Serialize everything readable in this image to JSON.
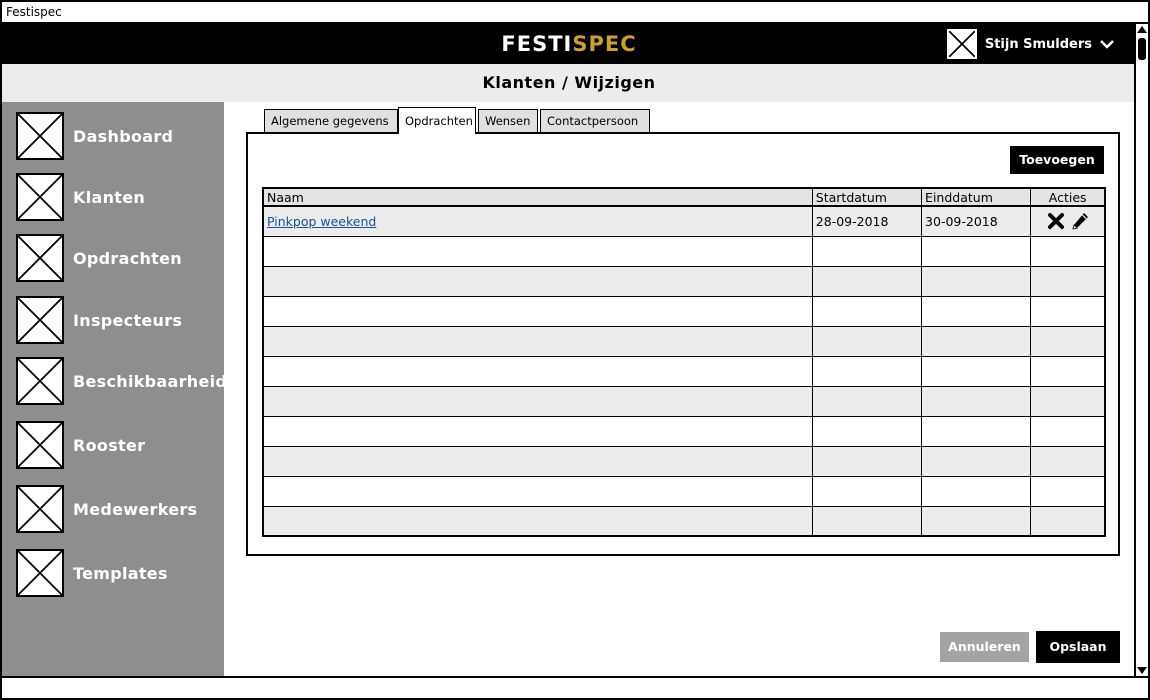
{
  "window": {
    "title": "Festispec"
  },
  "brand": {
    "part1": "FESTI",
    "part2": "SPEC",
    "accent_color": "#c9a227"
  },
  "user": {
    "name": "Stijn Smulders"
  },
  "page": {
    "title": "Klanten / Wijzigen"
  },
  "sidebar": {
    "items": [
      {
        "label": "Dashboard",
        "icon": "image-placeholder-icon"
      },
      {
        "label": "Klanten",
        "icon": "image-placeholder-icon"
      },
      {
        "label": "Opdrachten",
        "icon": "image-placeholder-icon"
      },
      {
        "label": "Inspecteurs",
        "icon": "image-placeholder-icon"
      },
      {
        "label": "Beschikbaarheid",
        "icon": "image-placeholder-icon"
      },
      {
        "label": "Rooster",
        "icon": "image-placeholder-icon"
      },
      {
        "label": "Medewerkers",
        "icon": "image-placeholder-icon"
      },
      {
        "label": "Templates",
        "icon": "image-placeholder-icon"
      }
    ]
  },
  "tabs": [
    {
      "label": "Algemene gegevens",
      "active": false
    },
    {
      "label": "Opdrachten",
      "active": true
    },
    {
      "label": "Wensen",
      "active": false
    },
    {
      "label": "Contactpersoon",
      "active": false
    }
  ],
  "panel": {
    "add_label": "Toevoegen",
    "table": {
      "columns": [
        "Naam",
        "Startdatum",
        "Einddatum",
        "Acties"
      ],
      "rows": [
        {
          "naam": "Pinkpop weekend",
          "startdatum": "28-09-2018",
          "einddatum": "30-09-2018"
        }
      ]
    }
  },
  "footer": {
    "cancel_label": "Annuleren",
    "save_label": "Opslaan"
  }
}
